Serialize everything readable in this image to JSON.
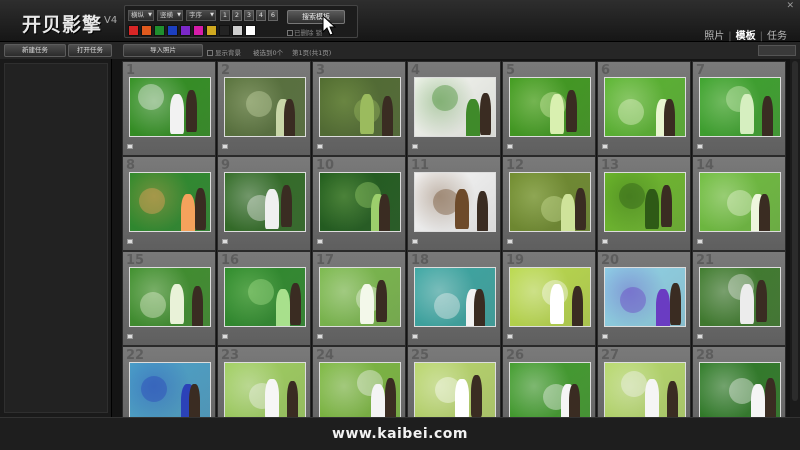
{
  "app": {
    "logo_text": "开贝影",
    "logo_char2": "擎",
    "logo_suffix": "V4"
  },
  "toolbar": {
    "dropdowns": [
      "横纵",
      "竖横",
      "字序"
    ],
    "numbers": [
      "1",
      "2",
      "3",
      "4",
      "6"
    ],
    "search_button": "搜索模板",
    "option_1": "已删除 锁",
    "swatch_colors": [
      "#d92626",
      "#e05a1e",
      "#1f8f2e",
      "#1c3fbf",
      "#7b28c9",
      "#d61ca8",
      "#cfa820",
      "#232323",
      "#cfcfcf",
      "#ffffff"
    ]
  },
  "nav": {
    "tabs": [
      "照片",
      "模板",
      "任务"
    ],
    "active": "模板"
  },
  "subbar": {
    "new_task": "新建任务",
    "open_task": "打开任务",
    "import_photos": "导入照片",
    "show_background": "显示背景",
    "selected_info": "被选到0个",
    "page_info": "第1页(共1页)"
  },
  "gallery": {
    "cells": [
      {
        "num": "1",
        "bg": "#2f8f1e",
        "accent": "#f2f2f2"
      },
      {
        "num": "2",
        "bg": "#56703a",
        "accent": "#c9d6a8"
      },
      {
        "num": "3",
        "bg": "#4f6a2f",
        "accent": "#9bbb5e"
      },
      {
        "num": "4",
        "bg": "#f4f6f0",
        "accent": "#3f8a2a"
      },
      {
        "num": "5",
        "bg": "#3e9a1c",
        "accent": "#d9f0b0"
      },
      {
        "num": "6",
        "bg": "#58b42e",
        "accent": "#e9f5d0"
      },
      {
        "num": "7",
        "bg": "#3aa22a",
        "accent": "#d6efc0"
      },
      {
        "num": "8",
        "bg": "#2a8a2a",
        "accent": "#f5a25c"
      },
      {
        "num": "9",
        "bg": "#2e6a22",
        "accent": "#f0f0f0"
      },
      {
        "num": "10",
        "bg": "#1d5a1a",
        "accent": "#9ccf6c"
      },
      {
        "num": "11",
        "bg": "#f7f7f7",
        "accent": "#6d4a2a"
      },
      {
        "num": "12",
        "bg": "#6e8a2c",
        "accent": "#cfe39a"
      },
      {
        "num": "13",
        "bg": "#6cb82a",
        "accent": "#2e5a16"
      },
      {
        "num": "14",
        "bg": "#6dbd3c",
        "accent": "#eef7dd"
      },
      {
        "num": "15",
        "bg": "#3c8e2a",
        "accent": "#e9f2d8"
      },
      {
        "num": "16",
        "bg": "#2c8a2a",
        "accent": "#a8e08c"
      },
      {
        "num": "17",
        "bg": "#79b84a",
        "accent": "#f3f8ea"
      },
      {
        "num": "18",
        "bg": "#3aa6a2",
        "accent": "#f2f2f2"
      },
      {
        "num": "19",
        "bg": "#b9d94a",
        "accent": "#ffffff"
      },
      {
        "num": "20",
        "bg": "#8fd2e6",
        "accent": "#6a3cc2"
      },
      {
        "num": "21",
        "bg": "#3c7a2a",
        "accent": "#ececec"
      },
      {
        "num": "22",
        "bg": "#4aa0c8",
        "accent": "#2b42b8"
      },
      {
        "num": "23",
        "bg": "#9fcf5e",
        "accent": "#f6f6f6"
      },
      {
        "num": "24",
        "bg": "#7bb83e",
        "accent": "#f4f4f4"
      },
      {
        "num": "25",
        "bg": "#b8d66a",
        "accent": "#ffffff"
      },
      {
        "num": "26",
        "bg": "#3f9c2a",
        "accent": "#f5f5f5"
      },
      {
        "num": "27",
        "bg": "#b6d96a",
        "accent": "#f5f5f5"
      },
      {
        "num": "28",
        "bg": "#2c7a24",
        "accent": "#f5f5f5"
      }
    ]
  },
  "footer": {
    "website": "www.kaibei.com"
  }
}
